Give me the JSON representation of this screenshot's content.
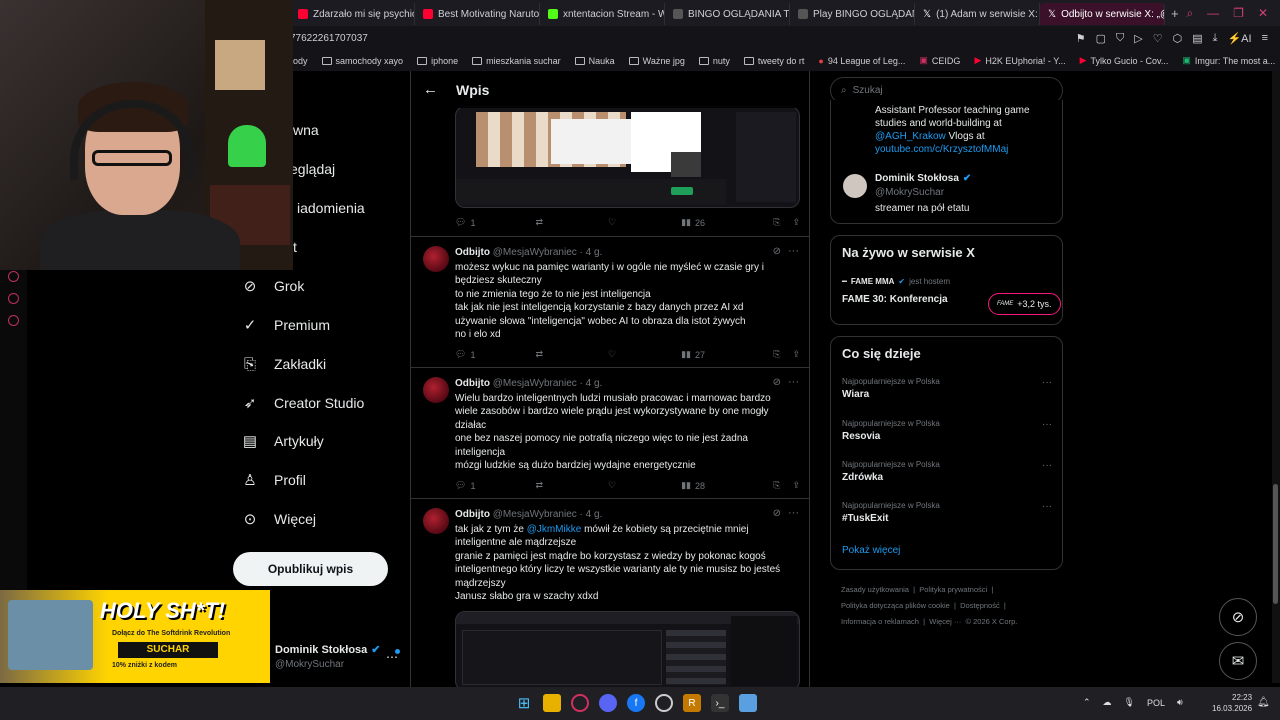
{
  "browser": {
    "tabs": [
      {
        "label": "Zdarzało mi się psychicz",
        "color": "#ff0033"
      },
      {
        "label": "Best Motivating Naruto S",
        "color": "#ff0033"
      },
      {
        "label": "xntentacion Stream - Wat",
        "color": "#53fc18"
      },
      {
        "label": "BINGO OGLĄDANIA TYRA",
        "color": "#888888"
      },
      {
        "label": "Play BINGO OGLĄDANIA",
        "color": "#888888"
      },
      {
        "label": "(1) Adam w serwisie X: „C",
        "color": "#ffffff"
      },
      {
        "label": "Odbijto w serwisie X: „@k",
        "color": "#ffffff"
      }
    ],
    "url_fragment": "77622261707037",
    "bookmarks": [
      "samochody xayo",
      "iphone",
      "mieszkania suchar",
      "Nauka",
      "Ważne jpg",
      "nuty",
      "tweety do rt",
      "94 League of Leg...",
      "CEIDG",
      "H2K EUphoria! - Y...",
      "Tylko Gucio - Cov...",
      "Imgur: The most a..."
    ],
    "bookmark_prefix": "hody",
    "ai_label": "AI"
  },
  "nav": {
    "items_partial": [
      "wna",
      "eglądaj",
      "iadomienia",
      "t"
    ],
    "items": [
      {
        "label": "Grok",
        "icon": "grok-icon",
        "glyph": "⊘"
      },
      {
        "label": "Premium",
        "icon": "premium-icon",
        "glyph": "✓"
      },
      {
        "label": "Zakładki",
        "icon": "bookmark-icon",
        "glyph": "🔖"
      },
      {
        "label": "Creator Studio",
        "icon": "rocket-icon",
        "glyph": "🚀"
      },
      {
        "label": "Artykuły",
        "icon": "article-icon",
        "glyph": "📄"
      },
      {
        "label": "Profil",
        "icon": "profile-icon",
        "glyph": "👤"
      },
      {
        "label": "Więcej",
        "icon": "more-icon",
        "glyph": "⋯"
      }
    ],
    "post_button": "Opublikuj wpis",
    "account": {
      "name": "Dominik Stokłosa",
      "handle": "@MokrySuchar"
    }
  },
  "promo": {
    "title": "HOLY SH*T!",
    "sub": "Dołącz do The Softdrink Revolution",
    "brand": "SUCHAR",
    "discount": "10% zniżki z kodem"
  },
  "feed": {
    "title": "Wpis",
    "top_stats": {
      "replies": "1",
      "views": "26"
    },
    "tweets": [
      {
        "name": "Odbijto",
        "handle": "@MesjaWybraniec",
        "age": "4 g.",
        "lines": [
          "możesz wykuc na pamięc warianty i w ogóle nie myśleć w czasie gry i",
          "będziesz skuteczny",
          "to nie zmienia tego że to nie jest inteligencja",
          "tak jak nie jest inteligencją korzystanie z bazy danych przez AI xd",
          "używanie słowa \"inteligencja\" wobec AI to obraza dla istot żywych",
          "no i elo xd"
        ],
        "replies": "1",
        "views": "27"
      },
      {
        "name": "Odbijto",
        "handle": "@MesjaWybraniec",
        "age": "4 g.",
        "lines": [
          "Wielu bardzo inteligentnych ludzi musiało pracowac i marnowac bardzo",
          "wiele zasobów i bardzo wiele prądu jest wykorzystywane by one mogły",
          "działac",
          "one bez naszej pomocy nie potrafią niczego więc to nie jest żadna",
          "inteligencja",
          "mózgi ludzkie są dużo bardziej wydajne energetycznie"
        ],
        "replies": "1",
        "views": "28"
      },
      {
        "name": "Odbijto",
        "handle": "@MesjaWybraniec",
        "age": "4 g.",
        "first_pre": "tak jak z tym że ",
        "mention": "@JkmMikke",
        "first_post": " mówił że kobiety są przeciętnie mniej",
        "lines": [
          "inteligentne ale mądrzejsze",
          "granie z pamięci jest mądre bo korzystasz z wiedzy by pokonac kogoś",
          "inteligentnego który liczy te wszystkie warianty ale ty nie musisz bo jesteś",
          "mądrzejszy",
          "Janusz słabo gra w szachy xdxd"
        ]
      }
    ]
  },
  "right": {
    "search_placeholder": "Szukaj",
    "bio_lines": [
      "Assistant Professor teaching game",
      "studies and world-building at"
    ],
    "bio_mention": "@AGH_Krakow",
    "bio_after": " Vlogs at",
    "bio_link": "youtube.com/c/KrzysztofMMaj",
    "user": {
      "name": "Dominik Stokłosa",
      "handle": "@MokrySuchar",
      "bio": "streamer na pół etatu"
    },
    "live": {
      "heading": "Na żywo w serwisie X",
      "host": "FAME MMA",
      "host_suffix": "jest hostem",
      "title": "FAME 30: Konferencja",
      "badge_logo": "FAME",
      "badge_count": "+3,2 tys."
    },
    "trends": {
      "heading": "Co się dzieje",
      "items": [
        {
          "context": "Najpopularniejsze w Polska",
          "topic": "Wiara"
        },
        {
          "context": "Najpopularniejsze w Polska",
          "topic": "Resovia"
        },
        {
          "context": "Najpopularniejsze w Polska",
          "topic": "Zdrówka"
        },
        {
          "context": "Najpopularniejsze w Polska",
          "topic": "#TuskExit"
        }
      ],
      "show_more": "Pokaż więcej"
    },
    "footer": [
      "Zasady użytkowania",
      "Polityka prywatności",
      "Polityka dotycząca plików cookie",
      "Dostępność",
      "Informacja o reklamach",
      "Więcej ···",
      "© 2026 X Corp."
    ]
  },
  "taskbar": {
    "lang": "POL",
    "time": "22:23",
    "date": "16.03.2026"
  },
  "colors": {
    "accent": "#1d9bf0",
    "live": "#f91880",
    "bg": "#000000",
    "promo": "#ffd400"
  }
}
